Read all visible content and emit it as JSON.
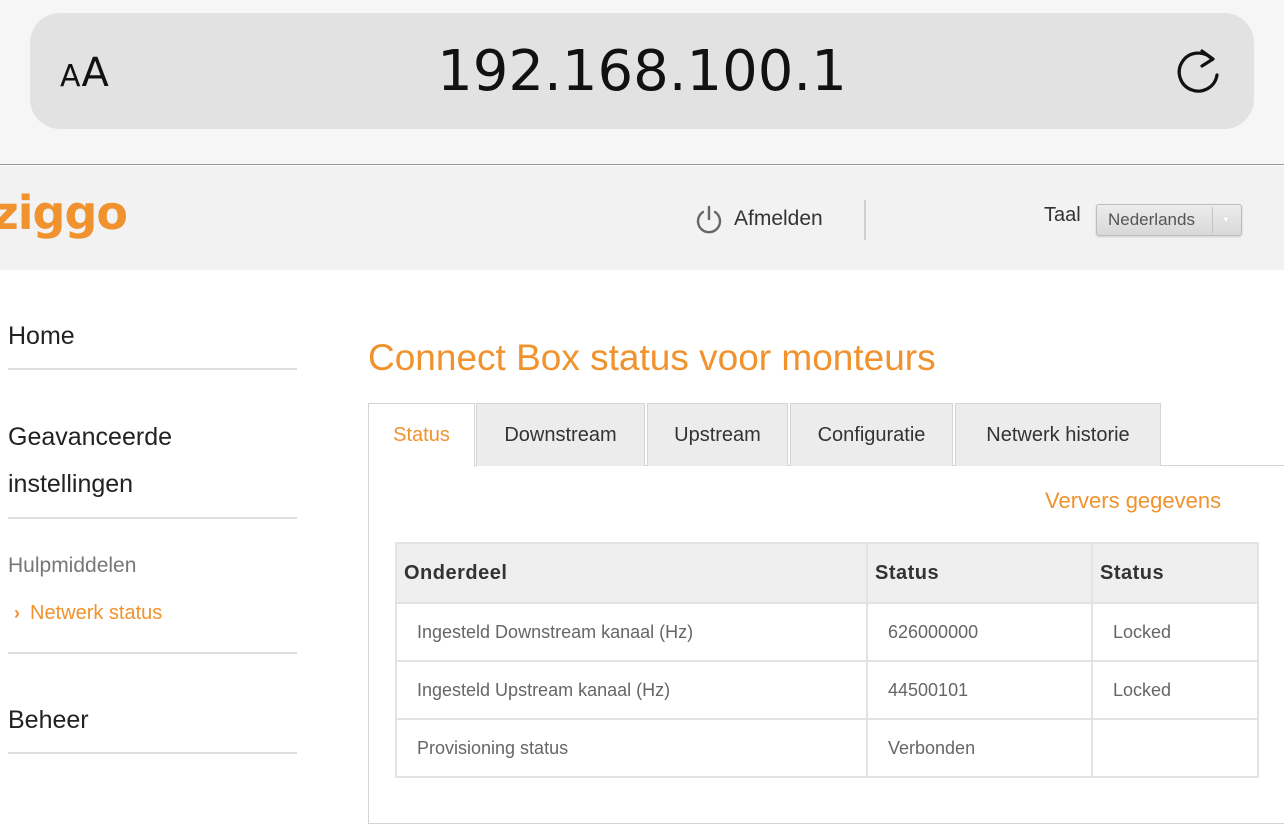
{
  "browser": {
    "text_size_small": "A",
    "text_size_big": "A",
    "url": "192.168.100.1"
  },
  "header": {
    "logo": "ziggo",
    "logout_label": "Afmelden",
    "language_label": "Taal",
    "language_value": "Nederlands"
  },
  "sidebar": {
    "home": "Home",
    "advanced_line1": "Geavanceerde",
    "advanced_line2": "instellingen",
    "tools": "Hulpmiddelen",
    "network_status": "Netwerk status",
    "admin": "Beheer"
  },
  "main": {
    "title": "Connect Box status voor monteurs",
    "tabs": [
      {
        "label": "Status"
      },
      {
        "label": "Downstream"
      },
      {
        "label": "Upstream"
      },
      {
        "label": "Configuratie"
      },
      {
        "label": "Netwerk historie"
      }
    ],
    "refresh_link": "Ververs gegevens",
    "table": {
      "headers": [
        "Onderdeel",
        "Status",
        "Status"
      ],
      "rows": [
        [
          "Ingesteld Downstream kanaal (Hz)",
          "626000000",
          "Locked"
        ],
        [
          "Ingesteld Upstream kanaal (Hz)",
          "44500101",
          "Locked"
        ],
        [
          "Provisioning status",
          "Verbonden",
          ""
        ]
      ]
    }
  },
  "colors": {
    "accent": "#f0922d"
  },
  "icons": {
    "reload": "reload-icon",
    "power": "power-icon",
    "dropdown": "chevron-down-icon",
    "chevron": "chevron-right-icon"
  }
}
